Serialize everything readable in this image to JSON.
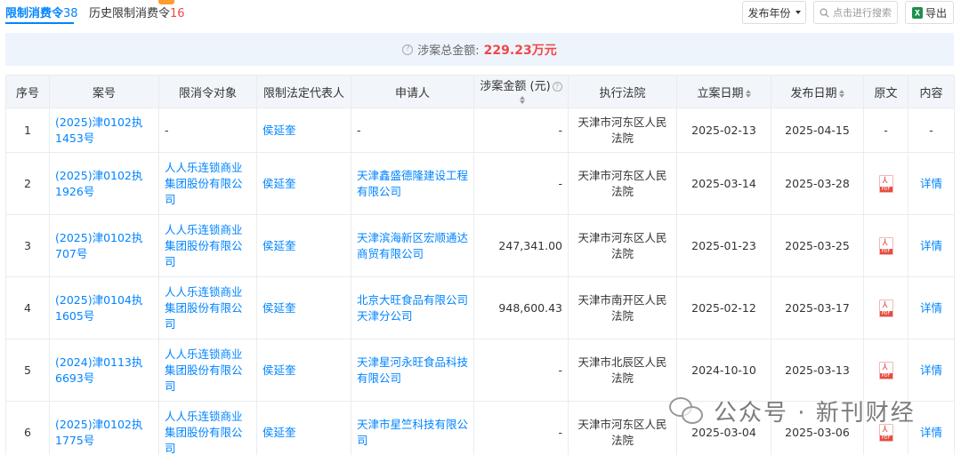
{
  "tabs": [
    {
      "label": "限制消费令",
      "count": "38"
    },
    {
      "label": "历史限制消费令",
      "count": "16"
    }
  ],
  "toolbar": {
    "year_button": "发布年份",
    "search_placeholder": "点击进行搜索",
    "export_button": "导出"
  },
  "summary": {
    "label": "涉案总金额:",
    "amount": "229.23万元"
  },
  "table": {
    "headers": [
      "序号",
      "案号",
      "限消令对象",
      "限制法定代表人",
      "申请人",
      "涉案金额 (元)",
      "执行法院",
      "立案日期",
      "发布日期",
      "原文",
      "内容"
    ],
    "rows": [
      {
        "no": "1",
        "case": "(2025)津0102执1453号",
        "target": "-",
        "rep": "侯延奎",
        "applicant": "-",
        "amount": "-",
        "court": "天津市河东区人民法院",
        "filed": "2025-02-13",
        "published": "2025-04-15",
        "original": "-",
        "detail": "-"
      },
      {
        "no": "2",
        "case": "(2025)津0102执1926号",
        "target": "人人乐连锁商业集团股份有限公司",
        "rep": "侯延奎",
        "applicant": "天津鑫盛德隆建设工程有限公司",
        "amount": "-",
        "court": "天津市河东区人民法院",
        "filed": "2025-03-14",
        "published": "2025-03-28",
        "original": "pdf",
        "detail": "详情"
      },
      {
        "no": "3",
        "case": "(2025)津0102执707号",
        "target": "人人乐连锁商业集团股份有限公司",
        "rep": "侯延奎",
        "applicant": "天津滨海新区宏顺通达商贸有限公司",
        "amount": "247,341.00",
        "court": "天津市河东区人民法院",
        "filed": "2025-01-23",
        "published": "2025-03-25",
        "original": "pdf",
        "detail": "详情"
      },
      {
        "no": "4",
        "case": "(2025)津0104执1605号",
        "target": "人人乐连锁商业集团股份有限公司",
        "rep": "侯延奎",
        "applicant": "北京大旺食品有限公司天津分公司",
        "amount": "948,600.43",
        "court": "天津市南开区人民法院",
        "filed": "2025-02-12",
        "published": "2025-03-17",
        "original": "pdf",
        "detail": "详情"
      },
      {
        "no": "5",
        "case": "(2024)津0113执6693号",
        "target": "人人乐连锁商业集团股份有限公司",
        "rep": "侯延奎",
        "applicant": "天津星河永旺食品科技有限公司",
        "amount": "-",
        "court": "天津市北辰区人民法院",
        "filed": "2024-10-10",
        "published": "2025-03-13",
        "original": "pdf",
        "detail": "详情"
      },
      {
        "no": "6",
        "case": "(2025)津0102执1775号",
        "target": "人人乐连锁商业集团股份有限公司",
        "rep": "侯延奎",
        "applicant": "天津市星竺科技有限公司",
        "amount": "-",
        "court": "天津市河东区人民法院",
        "filed": "2025-03-04",
        "published": "2025-03-06",
        "original": "pdf",
        "detail": "详情"
      }
    ]
  },
  "watermark": {
    "text": "公众号 · 新刊财经",
    "icon": "wechat-icon"
  },
  "colors": {
    "accent": "#0084ff",
    "alert": "#f04848",
    "summary_bg": "#edf4fc",
    "header_bg": "#f2f6fb"
  }
}
